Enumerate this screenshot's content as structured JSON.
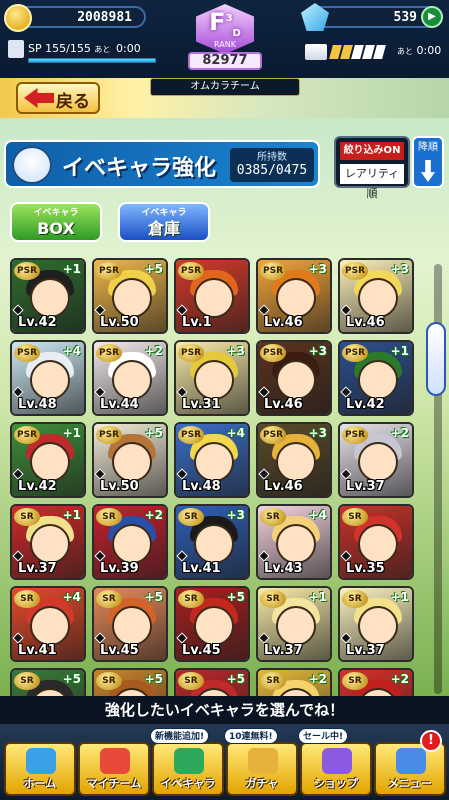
{
  "status": {
    "coins": "2008981",
    "gems": "539",
    "sp_label": "SP",
    "sp_value": "155/155",
    "sp_fraction": 1.0,
    "sp_ato": "あと",
    "sp_time": "0:00",
    "stamina_filled": 2,
    "stamina_total": 5,
    "stamina_ato": "あと",
    "stamina_time": "0:00"
  },
  "rank": {
    "letter": "F",
    "superscript": "3",
    "subscript": "D",
    "label": "RANK",
    "points": "82977",
    "team": "オムカラチーム"
  },
  "back_label": "戻る",
  "header": {
    "title": "イベキャラ強化",
    "owned_label": "所持数",
    "owned_value": "0385/0475"
  },
  "filter": {
    "on_label": "絞り込みON",
    "sort_label": "レアリティ順",
    "order_label": "降順"
  },
  "tabs": [
    {
      "small": "イベキャラ",
      "big": "BOX"
    },
    {
      "small": "イベキャラ",
      "big": "倉庫"
    }
  ],
  "cards": [
    {
      "rarity": "PSR",
      "plus": "+1",
      "level": "Lv.42",
      "color": "#2e6e2e",
      "hair": "#1f1f1f"
    },
    {
      "rarity": "PSR",
      "plus": "+5",
      "level": "Lv.50",
      "color": "#f0b74a",
      "hair": "#f2d14a"
    },
    {
      "rarity": "PSR",
      "plus": "",
      "level": "Lv.1",
      "color": "#d23a2a",
      "hair": "#e2651e"
    },
    {
      "rarity": "PSR",
      "plus": "+3",
      "level": "Lv.46",
      "color": "#f3a53a",
      "hair": "#e07b1c"
    },
    {
      "rarity": "PSR",
      "plus": "+3",
      "level": "Lv.46",
      "color": "#fbf0b8",
      "hair": "#f3d75a"
    },
    {
      "rarity": "PSR",
      "plus": "+4",
      "level": "Lv.48",
      "color": "#cde8f3",
      "hair": "#e8eef2"
    },
    {
      "rarity": "PSR",
      "plus": "+2",
      "level": "Lv.44",
      "color": "#f3eaea",
      "hair": "#ffffff"
    },
    {
      "rarity": "PSR",
      "plus": "+3",
      "level": "Lv.31",
      "color": "#f7e9a8",
      "hair": "#e6c93a"
    },
    {
      "rarity": "PSR",
      "plus": "+3",
      "level": "Lv.46",
      "color": "#5b3320",
      "hair": "#3a1d10"
    },
    {
      "rarity": "PSR",
      "plus": "+1",
      "level": "Lv.42",
      "color": "#2e4f8e",
      "hair": "#2b7a2b"
    },
    {
      "rarity": "PSR",
      "plus": "+1",
      "level": "Lv.42",
      "color": "#3f8f3a",
      "hair": "#c02a2a"
    },
    {
      "rarity": "PSR",
      "plus": "+5",
      "level": "Lv.50",
      "color": "#f3ecd8",
      "hair": "#b5753a"
    },
    {
      "rarity": "PSR",
      "plus": "+4",
      "level": "Lv.48",
      "color": "#3b6ec8",
      "hair": "#f3d64a"
    },
    {
      "rarity": "PSR",
      "plus": "+3",
      "level": "Lv.46",
      "color": "#5a4a2a",
      "hair": "#e6b23a"
    },
    {
      "rarity": "PSR",
      "plus": "+2",
      "level": "Lv.37",
      "color": "#e8e3ec",
      "hair": "#c9c6d2"
    },
    {
      "rarity": "SR",
      "plus": "+1",
      "level": "Lv.37",
      "color": "#d22a2a",
      "hair": "#f3e08a"
    },
    {
      "rarity": "SR",
      "plus": "+2",
      "level": "Lv.39",
      "color": "#c8202e",
      "hair": "#2a4fa8"
    },
    {
      "rarity": "SR",
      "plus": "+3",
      "level": "Lv.41",
      "color": "#2e5fb8",
      "hair": "#1a1a1a"
    },
    {
      "rarity": "SR",
      "plus": "+4",
      "level": "Lv.43",
      "color": "#f3d3e0",
      "hair": "#f3d07a"
    },
    {
      "rarity": "SR",
      "plus": "",
      "level": "Lv.35",
      "color": "#c9322a",
      "hair": "#d2332a"
    },
    {
      "rarity": "SR",
      "plus": "+4",
      "level": "Lv.41",
      "color": "#e64a2a",
      "hair": "#d2392a"
    },
    {
      "rarity": "SR",
      "plus": "+5",
      "level": "Lv.45",
      "color": "#e68a5a",
      "hair": "#d2642a"
    },
    {
      "rarity": "SR",
      "plus": "+5",
      "level": "Lv.45",
      "color": "#a82020",
      "hair": "#c2281e"
    },
    {
      "rarity": "SR",
      "plus": "+1",
      "level": "Lv.37",
      "color": "#f7eba8",
      "hair": "#f3e4a0"
    },
    {
      "rarity": "SR",
      "plus": "+1",
      "level": "Lv.37",
      "color": "#fbf2c0",
      "hair": "#f4e28a"
    },
    {
      "rarity": "SR",
      "plus": "+5",
      "level": "",
      "color": "#3a7a3a",
      "hair": "#2a2a2a"
    },
    {
      "rarity": "SR",
      "plus": "+5",
      "level": "",
      "color": "#c9832a",
      "hair": "#a85a1e"
    },
    {
      "rarity": "SR",
      "plus": "+5",
      "level": "",
      "color": "#b8282a",
      "hair": "#c02a2a"
    },
    {
      "rarity": "SR",
      "plus": "+2",
      "level": "",
      "color": "#e2b83a",
      "hair": "#f3d36a"
    },
    {
      "rarity": "SR",
      "plus": "+2",
      "level": "",
      "color": "#d6302a",
      "hair": "#c02020"
    }
  ],
  "instruction": "強化したいイベキャラを選んでね！",
  "nav": [
    {
      "label": "ホーム",
      "badge": "",
      "icon": "home-icon"
    },
    {
      "label": "マイチーム",
      "badge": "",
      "icon": "my-team-icon"
    },
    {
      "label": "イベキャラ",
      "badge": "新機能追加!",
      "icon": "event-chara-icon"
    },
    {
      "label": "ガチャ",
      "badge": "10連無料!",
      "icon": "gacha-icon"
    },
    {
      "label": "ショップ",
      "badge": "セール中!",
      "icon": "shop-icon"
    },
    {
      "label": "メニュー",
      "badge": "",
      "icon": "menu-icon"
    }
  ],
  "alert_mark": "!",
  "colors": {
    "accent_blue": "#1b84d1",
    "accent_gold": "#f1c23d",
    "filter_red": "#c81d1d"
  }
}
